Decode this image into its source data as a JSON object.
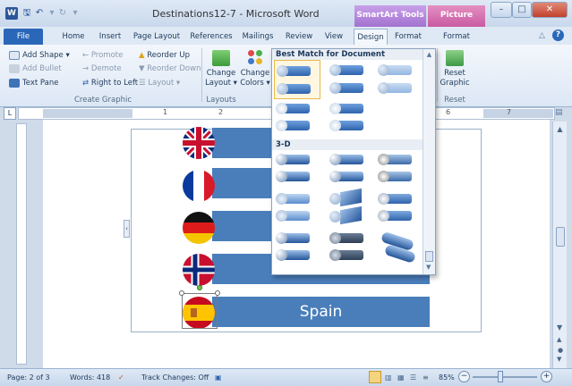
{
  "window": {
    "title": "Destinations12-7 - Microsoft Word",
    "app_icon_letter": "W"
  },
  "context_tabs": {
    "smartart": "SmartArt Tools",
    "picture": "Picture Tools"
  },
  "tabs": [
    "File",
    "Home",
    "Insert",
    "Page Layout",
    "References",
    "Mailings",
    "Review",
    "View",
    "Design",
    "Format",
    "Format"
  ],
  "ribbon": {
    "create_graphic": {
      "add_shape": "Add Shape",
      "add_bullet": "Add Bullet",
      "text_pane": "Text Pane",
      "promote": "Promote",
      "demote": "Demote",
      "right_to_left": "Right to Left",
      "reorder_up": "Reorder Up",
      "reorder_down": "Reorder Down",
      "layout": "Layout",
      "label": "Create Graphic"
    },
    "layouts": {
      "change_layout_1": "Change",
      "change_layout_2": "Layout",
      "label": "Layouts"
    },
    "colors": {
      "change_colors_1": "Change",
      "change_colors_2": "Colors"
    },
    "reset": {
      "reset_graphic_1": "Reset",
      "reset_graphic_2": "Graphic",
      "label": "Reset"
    }
  },
  "ruler_numbers": [
    "1",
    "2",
    "6",
    "7"
  ],
  "gallery": {
    "best_match": "Best Match for Document",
    "three_d": "3-D"
  },
  "document": {
    "spain_label": "Spain"
  },
  "status": {
    "page": "Page: 2 of 3",
    "words": "Words: 418",
    "track": "Track Changes: Off",
    "zoom": "85%"
  }
}
